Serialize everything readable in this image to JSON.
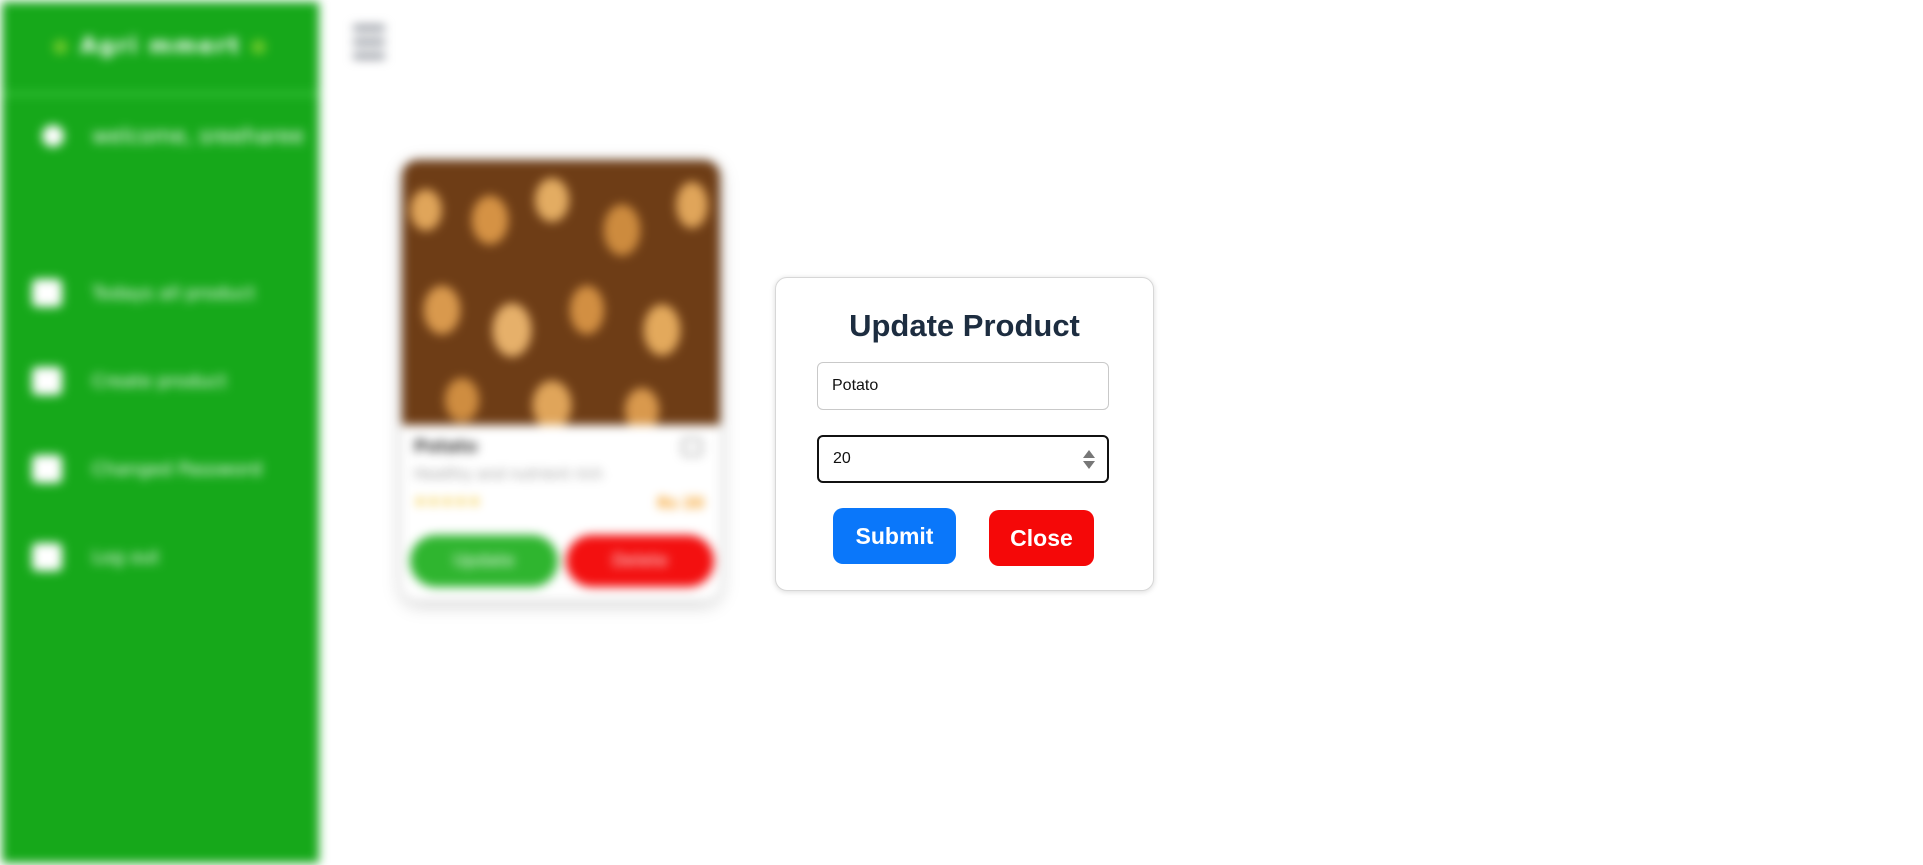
{
  "sidebar": {
    "brand": "Agri  mmert",
    "welcome": "welcome, sreeharee",
    "items": [
      {
        "label": "Todays all product",
        "icon": "home-icon"
      },
      {
        "label": "Create product",
        "icon": "cart-icon"
      },
      {
        "label": "Changed Password",
        "icon": "lock-icon"
      },
      {
        "label": "Log out",
        "icon": "logout-icon"
      }
    ]
  },
  "header": {
    "menu_icon": "hamburger-icon"
  },
  "product_card": {
    "name": "Potato",
    "description": "Healthy and nutrient rich",
    "price": "Rs 20",
    "rating": 5,
    "update_label": "Update",
    "delete_label": "Delete"
  },
  "modal": {
    "title": "Update Product",
    "name_value": "Potato",
    "quantity_value": "20",
    "submit_label": "Submit",
    "close_label": "Close"
  },
  "colors": {
    "sidebar": "#16a81a",
    "submit": "#0a77fa",
    "close": "#f50808"
  }
}
